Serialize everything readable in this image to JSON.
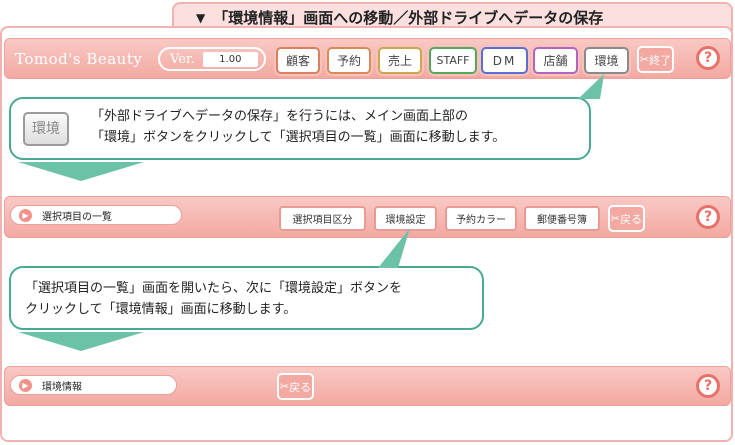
{
  "title": "「環境情報」画面への移動／外部ドライブへデータの保存",
  "title_marker": "▼",
  "toolbar": {
    "brand": "Tomod's Beauty",
    "ver_label": "Ver.",
    "ver_value": "1.00",
    "buttons": [
      "顧客",
      "予約",
      "売上",
      "STAFF",
      "DM",
      "店舗",
      "環境"
    ],
    "exit_label": "終了",
    "help_label": "?"
  },
  "callout1": {
    "icon_label": "環境",
    "line1": "「外部ドライブへデータの保存」を行うには、メイン画面上部の",
    "line2": "「環境」ボタンをクリックして「選択項目の一覧」画面に移動します。"
  },
  "screen2": {
    "field_label": "選択項目の一覧",
    "buttons": [
      "選択項目区分",
      "環境設定",
      "予約カラー",
      "郵便番号簿"
    ],
    "back_label": "戻る",
    "help_label": "?"
  },
  "callout2": {
    "line1": "「選択項目の一覧」画面を開いたら、次に「環境設定」ボタンを",
    "line2": "クリックして「環境情報」画面に移動します。"
  },
  "screen3": {
    "field_label": "環境情報",
    "back_label": "戻る",
    "help_label": "?"
  },
  "colors": {
    "bar": "#f3a9a2",
    "frame": "#f2b2b0",
    "callout_border": "#4aa991",
    "arrow": "#6cc2a7"
  }
}
